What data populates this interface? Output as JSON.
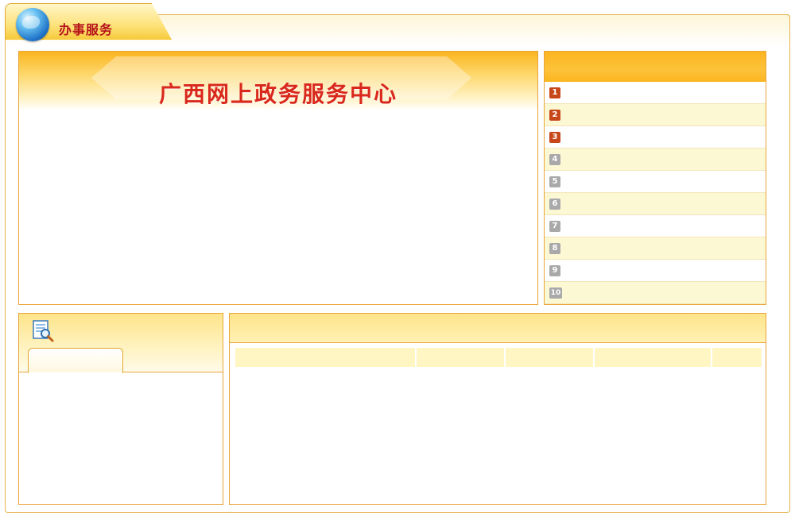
{
  "header": {
    "title": "办事服务",
    "icon": "globe-icon"
  },
  "banner": {
    "title": "广西网上政务服务中心"
  },
  "rank_list": {
    "items": [
      {
        "num": "1",
        "label": ""
      },
      {
        "num": "2",
        "label": ""
      },
      {
        "num": "3",
        "label": ""
      },
      {
        "num": "4",
        "label": ""
      },
      {
        "num": "5",
        "label": ""
      },
      {
        "num": "6",
        "label": ""
      },
      {
        "num": "7",
        "label": ""
      },
      {
        "num": "8",
        "label": ""
      },
      {
        "num": "9",
        "label": ""
      },
      {
        "num": "10",
        "label": ""
      }
    ]
  },
  "search_panel": {
    "icon": "search-document-icon"
  },
  "colors": {
    "accent_orange": "#fbb520",
    "title_red": "#d9281c",
    "header_red": "#b5121b",
    "border": "#e9a43a",
    "rank_top": "#c8471a",
    "rank_rest": "#a9a9a9"
  }
}
